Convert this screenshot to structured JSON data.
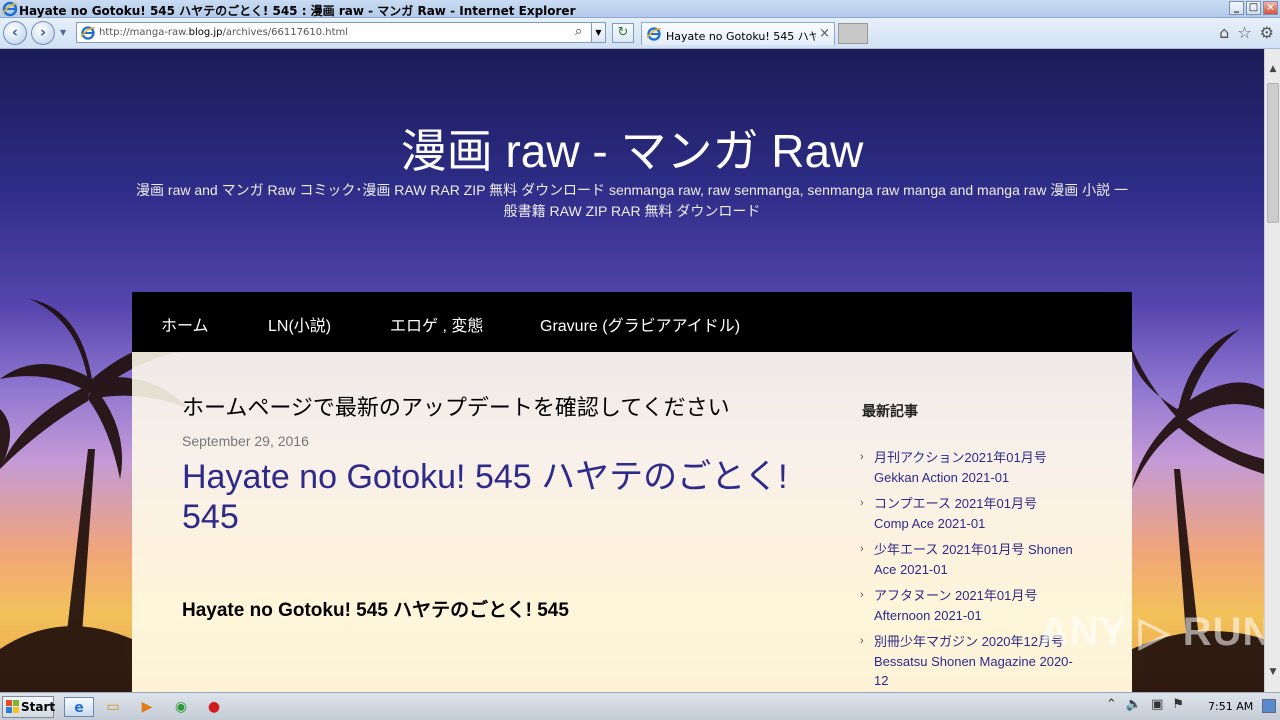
{
  "window": {
    "title": "Hayate no Gotoku! 545 ハヤテのごとく! 545 : 漫画 raw - マンガ Raw - Internet Explorer",
    "controls": [
      "_",
      "□",
      "×"
    ]
  },
  "browser": {
    "address_prefix": "http://manga-raw.",
    "address_domain": "blog.jp",
    "address_path": "/archives/66117610.html",
    "tab_title": "Hayate no Gotoku! 545 ハヤ...",
    "icons": [
      "back-icon",
      "forward-icon",
      "search-icon",
      "refresh-icon",
      "home-icon",
      "favorites-icon",
      "tools-icon"
    ]
  },
  "site": {
    "title": "漫画 raw - マンガ Raw",
    "description": "漫画 raw and マンガ Raw コミック･漫画 RAW RAR ZIP 無料 ダウンロード senmanga raw, raw senmanga, senmanga raw manga and manga raw 漫画 小説 一般書籍 RAW ZIP RAR 無料 ダウンロード",
    "menu": [
      "ホーム",
      "LN(小説)",
      "エロゲ , 変態",
      "Gravure (グラビアアイドル)"
    ]
  },
  "post": {
    "notice": "ホームページで最新のアップデートを確認してください",
    "date": "September 29, 2016",
    "title": "Hayate no Gotoku! 545 ハヤテのごとく! 545",
    "heading": "Hayate no Gotoku! 545 ハヤテのごとく! 545"
  },
  "sidebar": {
    "title": "最新記事",
    "items": [
      "月刊アクション2021年01月号 Gekkan Action 2021-01",
      "コンプエース 2021年01月号 Comp Ace 2021-01",
      "少年エース 2021年01月号 Shonen Ace 2021-01",
      "アフタヌーン 2021年01月号 Afternoon 2021-01",
      "別冊少年マガジン 2020年12月号 Bessatsu Shonen Magazine 2020-12"
    ]
  },
  "watermark": "ANY ▷ RUN",
  "taskbar": {
    "start_label": "Start",
    "clock": "7:51 AM"
  }
}
